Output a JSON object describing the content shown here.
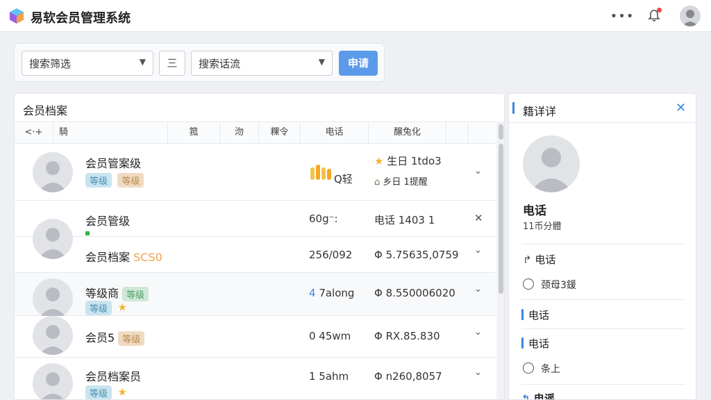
{
  "app": {
    "title": "易软会员管理系统"
  },
  "filters": {
    "select1_value": "搜索筛选",
    "middle_button": "三",
    "select2_value": "搜索话流",
    "apply_label": "申请"
  },
  "members": {
    "title": "会员档案",
    "columns": [
      "<·+",
      "騎",
      "箛",
      "沕",
      "粿令",
      "电话",
      "醸兔化"
    ],
    "rows": [
      {
        "name": "会员管案级",
        "tags": [
          "等级",
          "等级"
        ],
        "col_mid": "Q轻",
        "birthday": "生日 1tdo3",
        "note": "乡日 1提醒"
      },
      {
        "name": "会员管级",
        "col_mid": "60g⁻:",
        "phone": "电话 1403 1"
      },
      {
        "name": "会员档案",
        "name_code": "SCS0",
        "col_mid": "256/0​92",
        "phone": "Φ 5.75635,0759"
      },
      {
        "name": "等级商",
        "tags": [
          "等级",
          "等级"
        ],
        "col_mid_num": "4",
        "col_mid": "7along",
        "phone": "Φ 8.550006020"
      },
      {
        "name": "会员5",
        "tags": [
          "等级"
        ],
        "col_mid": "0 45wm",
        "phone": "Φ RX.85.830"
      },
      {
        "name": "会员档案员",
        "tags": [
          "等级"
        ],
        "col_mid": "1 5ahm",
        "phone": "Φ n260,8057"
      }
    ]
  },
  "detail": {
    "title": "籍详详",
    "heading": "电话",
    "sub": "11币分體",
    "link1": "电话",
    "radio1": "颈母3鍰",
    "section1": "电话",
    "section2": "电话",
    "radio2": "条上",
    "section3": "电谣"
  },
  "colors": {
    "accent": "#3b86e0",
    "apply": "#5b9ae8",
    "star": "#f2b431"
  }
}
